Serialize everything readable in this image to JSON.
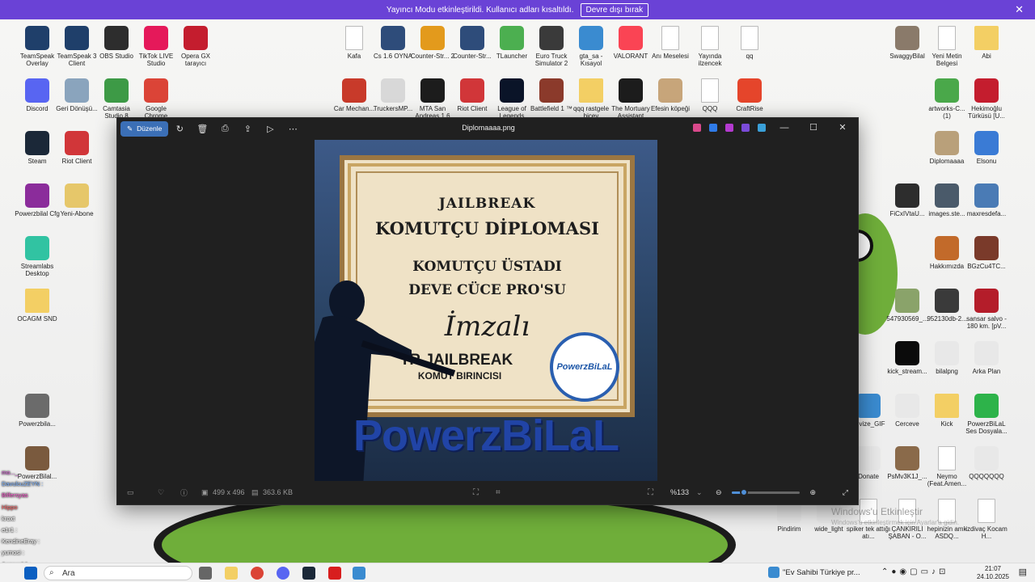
{
  "banner": {
    "text": "Yayıncı Modu etkinleştirildi. Kullanıcı adları kısaltıldı.",
    "button": "Devre dışı bırak"
  },
  "desktop_icons": [
    {
      "label": "TeamSpeak Overlay",
      "color": "#1f3f6a"
    },
    {
      "label": "TeamSpeak 3 Client",
      "color": "#1f3f6a"
    },
    {
      "label": "OBS Studio",
      "color": "#2d2d2d"
    },
    {
      "label": "TikTok LIVE Studio",
      "color": "#e5195a"
    },
    {
      "label": "Opera GX tarayıcı",
      "color": "#c41d2e"
    },
    {
      "label": "Discord",
      "color": "#5865f2"
    },
    {
      "label": "Geri Dönüşü...",
      "color": "#8aa4bd"
    },
    {
      "label": "Camtasia Studio 8",
      "color": "#3d9a46"
    },
    {
      "label": "Google Chrome",
      "color": "#db4437"
    },
    {
      "label": "Steam",
      "color": "#1b2838"
    },
    {
      "label": "Riot Client",
      "color": "#d13639"
    },
    {
      "label": "Powerzbilal Cfg",
      "color": "#8b2c9b"
    },
    {
      "label": "Yeni-Abone",
      "color": "#e6c76a"
    },
    {
      "label": "Streamlabs Desktop",
      "color": "#31c3a2"
    },
    {
      "label": "OCAGM SND",
      "color": "#f3cf64"
    },
    {
      "label": "Powerzbila...",
      "color": "#6b6b6b"
    },
    {
      "label": "PowerzBilal...",
      "color": "#7a5a3e"
    },
    {
      "label": "Kafa",
      "color": "#ffffff"
    },
    {
      "label": "Cs 1.6 OYNA",
      "color": "#2e4c7a"
    },
    {
      "label": "Counter-Str... 2",
      "color": "#e39a1c"
    },
    {
      "label": "Counter-Str...",
      "color": "#2e4c7a"
    },
    {
      "label": "TLauncher",
      "color": "#4caf50"
    },
    {
      "label": "Euro Truck Simulator 2",
      "color": "#3a3a3a"
    },
    {
      "label": "gta_sa - Kısayol",
      "color": "#3a8bd0"
    },
    {
      "label": "VALORANT",
      "color": "#fa4454"
    },
    {
      "label": "Anı Meselesi",
      "color": "#ffffff"
    },
    {
      "label": "Yayında ilzencek",
      "color": "#ffffff"
    },
    {
      "label": "qq",
      "color": "#ffffff"
    },
    {
      "label": "Car Mechan...",
      "color": "#c83a2a"
    },
    {
      "label": "TruckersMP...",
      "color": "#d8d8d8"
    },
    {
      "label": "MTA San Andreas 1.6",
      "color": "#1c1c1c"
    },
    {
      "label": "Riot Client",
      "color": "#d13639"
    },
    {
      "label": "League of Legends",
      "color": "#0a1428"
    },
    {
      "label": "Battlefield 1 ™",
      "color": "#8b3a2b"
    },
    {
      "label": "qqq rastgele bicey",
      "color": "#f3cf64"
    },
    {
      "label": "The Mortuary Assistant",
      "color": "#1c1c1c"
    },
    {
      "label": "Efesin köpeği",
      "color": "#c7a57a"
    },
    {
      "label": "QQQ",
      "color": "#ffffff"
    },
    {
      "label": "CraftRise",
      "color": "#e5452b"
    },
    {
      "label": "SwaggyBilal",
      "color": "#8a7a6a"
    },
    {
      "label": "Yeni Metin Belgesi",
      "color": "#ffffff"
    },
    {
      "label": "Abi",
      "color": "#f3cf64"
    },
    {
      "label": "artworks-C... (1)",
      "color": "#4aa84a"
    },
    {
      "label": "Hekimoğlu Türküsü [U...",
      "color": "#c41d2e"
    },
    {
      "label": "Diplomaaaa",
      "color": "#b9a07a"
    },
    {
      "label": "Elsonu",
      "color": "#3a7bd5"
    },
    {
      "label": "FiCxIVtaU...",
      "color": "#2d2d2d"
    },
    {
      "label": "images.ste...",
      "color": "#4a5a6a"
    },
    {
      "label": "maxresdefa...",
      "color": "#4a7bb5"
    },
    {
      "label": "Hakkımızda",
      "color": "#c26a2a"
    },
    {
      "label": "BGzCu4TC...",
      "color": "#7a3a2a"
    },
    {
      "label": "547930569_...",
      "color": "#8aa36a"
    },
    {
      "label": "952130db-2...",
      "color": "#3a3a3a"
    },
    {
      "label": "sansar salvo - 180 km. [pV...",
      "color": "#b41d2a"
    },
    {
      "label": "kick_stream...",
      "color": "#0b0b0b"
    },
    {
      "label": "bilalpng",
      "color": "#e8e8e8"
    },
    {
      "label": "Arka Plan",
      "color": "#e8e8e8"
    },
    {
      "label": "devize_GIF",
      "color": "#3a8bd0"
    },
    {
      "label": "Cerceve",
      "color": "#e8e8e8"
    },
    {
      "label": "Kick",
      "color": "#f3cf64"
    },
    {
      "label": "PowerzBiLaL Ses Dosyala...",
      "color": "#2db34a"
    },
    {
      "label": "Donate",
      "color": "#e8e8e8"
    },
    {
      "label": "PsMv3K1J_...",
      "color": "#8a6a4a"
    },
    {
      "label": "Neymo (Feat.Amen...",
      "color": "#ffffff"
    },
    {
      "label": "QQQQQQQ",
      "color": "#e8e8e8"
    },
    {
      "label": "Pindirim",
      "color": "#e8e8e8"
    },
    {
      "label": "wide_light",
      "color": "#e8e8e8"
    },
    {
      "label": "spiker tek attığı atı...",
      "color": "#ffffff"
    },
    {
      "label": "ÇANKIRILI ŞABAN - O...",
      "color": "#ffffff"
    },
    {
      "label": "hepinizin amk ASDQ...",
      "color": "#ffffff"
    },
    {
      "label": "izdivaç Kocam H...",
      "color": "#ffffff"
    }
  ],
  "viewer": {
    "title": "Diplomaaaa.png",
    "edit_label": "Düzenle",
    "dimensions": "499 x 496",
    "size": "363.6 KB",
    "zoom": "%133",
    "zoom_level": 0.18
  },
  "certificate": {
    "line1": "JAILBREAK",
    "line2": "KOMUTÇU DİPLOMASI",
    "line3": "KOMUTÇU ÜSTADI",
    "line4": "DEVE CÜCE PRO'SU",
    "signature": "İmzalı",
    "line5": "TR JAILBREAK",
    "line6": "KOMUT BIRINCISI",
    "seal": "PowerzBiLaL",
    "brand": "PowerzBiLaL"
  },
  "chat": [
    {
      "user": "mo..._",
      "color": "#d65bd6"
    },
    {
      "user": "DavulcuZEYN :",
      "color": "#7fb4ff"
    },
    {
      "user": "Bilfersyas",
      "color": "#ff5ad2"
    },
    {
      "user": "Hippo",
      "color": "#ff6464"
    },
    {
      "user": "kroxt",
      "color": "#ffffff"
    },
    {
      "user": "e1r1 :",
      "color": "#ffffff"
    },
    {
      "user": "KendineEray :",
      "color": "#ffffff"
    },
    {
      "user": "yumosi :",
      "color": "#ffffff"
    },
    {
      "user": "Aozora14 :",
      "color": "#ff6ad2"
    },
    {
      "user": "yumosi :",
      "color": "#ffffff"
    }
  ],
  "watermark": {
    "line1": "Windows'u Etkinleştir",
    "line2": "Windows'u etkinleştirmek için Ayarlar'a gidin."
  },
  "taskbar": {
    "search": "Ara",
    "news": "\"Ev Sahibi Türkiye pr...",
    "time": "21:07",
    "date": "24.10.2025"
  }
}
